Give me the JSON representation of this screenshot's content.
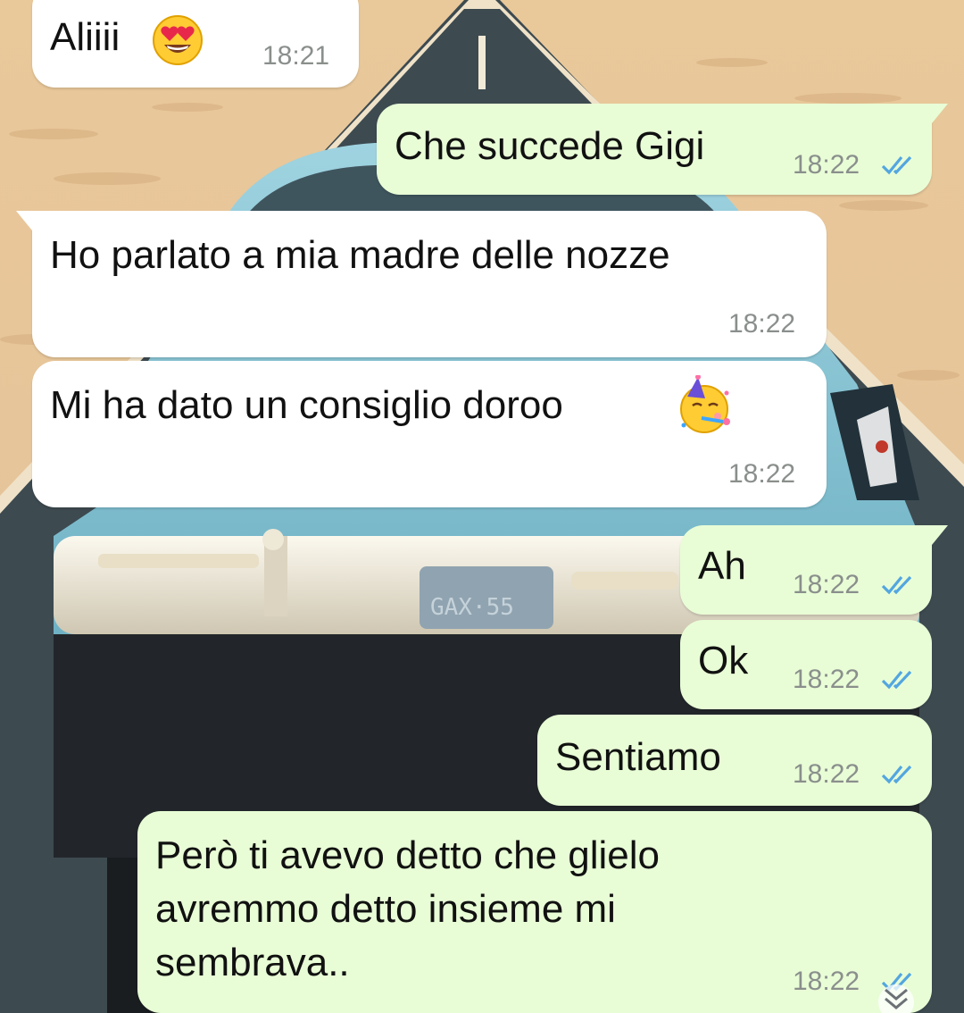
{
  "messages": [
    {
      "direction": "incoming",
      "text": "Aliiii",
      "emoji": "smiling-face-with-heart-eyes",
      "time": "18:21"
    },
    {
      "direction": "outgoing",
      "text": "Che succede Gigi",
      "time": "18:22",
      "status": "read"
    },
    {
      "direction": "incoming",
      "text": "Ho parlato a mia madre delle nozze",
      "time": "18:22"
    },
    {
      "direction": "incoming",
      "text": "Mi ha dato un consiglio doroo",
      "emoji": "partying-face",
      "time": "18:22"
    },
    {
      "direction": "outgoing",
      "text": "Ah",
      "time": "18:22",
      "status": "read"
    },
    {
      "direction": "outgoing",
      "text": "Ok",
      "time": "18:22",
      "status": "read"
    },
    {
      "direction": "outgoing",
      "text": "Sentiamo",
      "time": "18:22",
      "status": "read"
    },
    {
      "direction": "outgoing",
      "text": "Però ti avevo detto che glielo avremmo detto insieme mi sembrava..",
      "time": "18:22",
      "status": "read"
    }
  ],
  "colors": {
    "incoming_bubble": "#ffffff",
    "outgoing_bubble": "#e8fdd6",
    "read_ticks": "#53a6e0",
    "timestamp": "#8a8f8c"
  },
  "icons": {
    "read_receipt": "double-check-icon",
    "scroll_down": "double-chevron-down-icon"
  }
}
